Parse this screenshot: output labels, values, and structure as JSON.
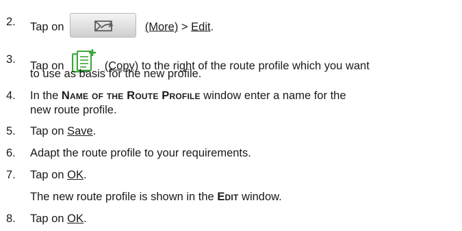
{
  "steps": [
    {
      "num": "2.",
      "pre": "Tap on",
      "icon": "more-button-icon",
      "link1": "(More)",
      "mid": " > ",
      "link2": "Edit",
      "post": "."
    },
    {
      "num": "3.",
      "pre": "Tap on",
      "icon": "copy-icon",
      "link1": "(Copy)",
      "post1": " to the right of the route profile which you want",
      "line2": "to use as basis for the new profile."
    },
    {
      "num": "4.",
      "pre": "In the ",
      "bold": "Name of the Route Profile",
      "post1": " window enter a name for the",
      "line2": "new route profile."
    },
    {
      "num": "5.",
      "pre": "Tap on ",
      "link1": "Save",
      "post": "."
    },
    {
      "num": "6.",
      "text": "Adapt the route profile to your requirements."
    },
    {
      "num": "7.",
      "pre": "Tap on ",
      "link1": "OK",
      "post": ".",
      "line2_pre": "The new route profile is shown in the ",
      "line2_bold": "Edit",
      "line2_post": " window."
    },
    {
      "num": "8.",
      "pre": "Tap on ",
      "link1": "OK",
      "post": "."
    }
  ],
  "colors": {
    "text": "#1a1a1a",
    "icon_green": "#3aa53a",
    "icon_gray": "#5a5a5a"
  }
}
